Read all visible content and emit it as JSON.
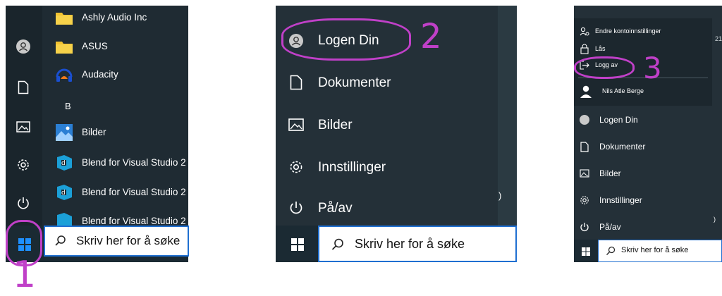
{
  "panel1": {
    "apps": [
      {
        "label": "Ashly Audio Inc",
        "icon": "folder-icon"
      },
      {
        "label": "ASUS",
        "icon": "folder-icon"
      },
      {
        "label": "Audacity",
        "icon": "audacity-icon"
      },
      {
        "label": "B",
        "icon": ""
      },
      {
        "label": "Bilder",
        "icon": "photos-icon"
      },
      {
        "label": "Blend for Visual Studio 2",
        "icon": "blend-icon"
      },
      {
        "label": "Blend for Visual Studio 2",
        "icon": "blend-icon"
      },
      {
        "label": "Blend for Visual Studio 2",
        "icon": "blend-icon"
      }
    ],
    "search_text": "Skriv her for å søke",
    "step_number": "1"
  },
  "panel2": {
    "menu": [
      {
        "label": "Logen Din",
        "icon": "user-icon"
      },
      {
        "label": "Dokumenter",
        "icon": "document-icon"
      },
      {
        "label": "Bilder",
        "icon": "pictures-icon"
      },
      {
        "label": "Innstillinger",
        "icon": "gear-icon"
      },
      {
        "label": "På/av",
        "icon": "power-icon"
      }
    ],
    "edge_char": ")",
    "search_text": "Skriv her for å søke",
    "step_number": "2"
  },
  "panel3": {
    "popup": {
      "items": [
        {
          "label": "Endre kontoinnstillinger",
          "icon": "account-settings-icon"
        },
        {
          "label": "Lås",
          "icon": "lock-icon"
        },
        {
          "label": "Logg av",
          "icon": "sign-out-icon"
        }
      ],
      "user_name": "Nils Atle Berge"
    },
    "edge_text": "21",
    "menu": [
      {
        "label": "Logen Din",
        "icon": "user-icon"
      },
      {
        "label": "Dokumenter",
        "icon": "document-icon"
      },
      {
        "label": "Bilder",
        "icon": "pictures-icon"
      },
      {
        "label": "Innstillinger",
        "icon": "gear-icon"
      },
      {
        "label": "På/av",
        "icon": "power-icon"
      }
    ],
    "edge_char": ")",
    "search_text": "Skriv her for å søke",
    "step_number": "3"
  },
  "colors": {
    "highlight": "#c040c8",
    "start_dark": "#1f2b33",
    "taskbar": "#1b2a33",
    "search_border": "#1f6fd1",
    "windows_blue": "#1e90ff"
  }
}
